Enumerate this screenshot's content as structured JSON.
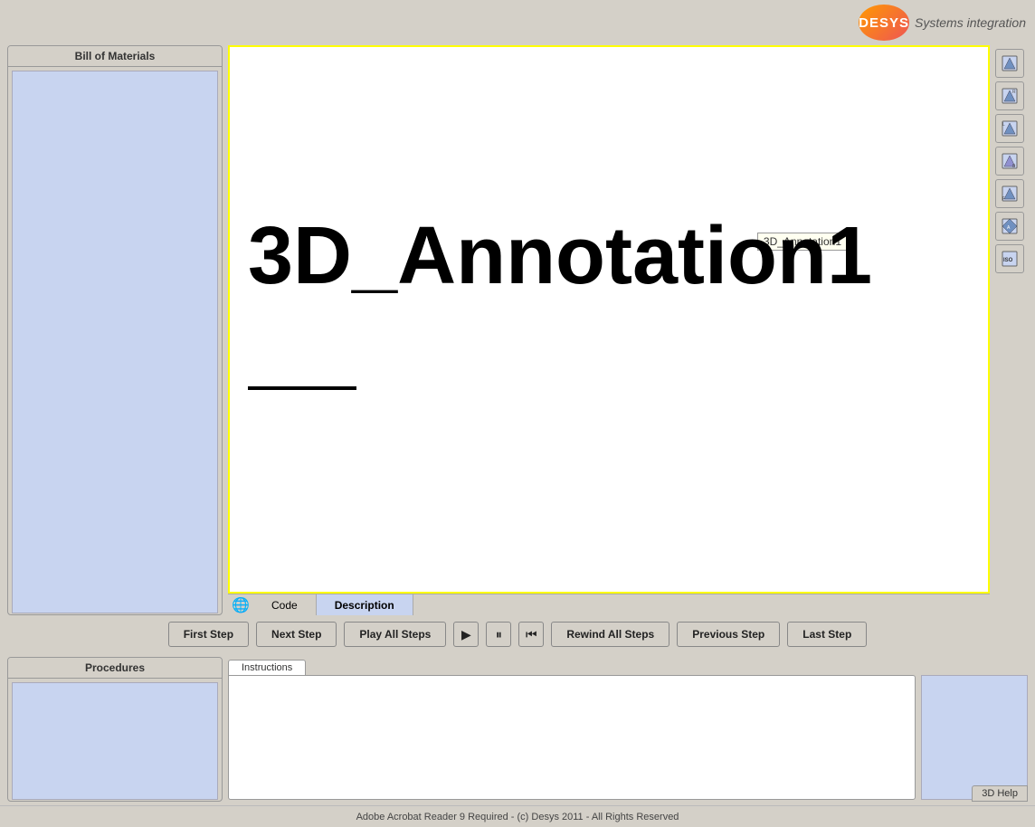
{
  "header": {
    "logo_text": "DESYS",
    "tagline": "Systems integration"
  },
  "bom": {
    "title": "Bill of Materials"
  },
  "viewport": {
    "annotation_tooltip": "3D_Annotation1",
    "annotation_main": "3D_Annotation1"
  },
  "tabs": {
    "code_label": "Code",
    "description_label": "Description"
  },
  "view_buttons": [
    {
      "label": "T",
      "name": "top-view"
    },
    {
      "label": "R",
      "name": "right-view"
    },
    {
      "label": "L",
      "name": "left-view"
    },
    {
      "label": "B",
      "name": "back-view"
    },
    {
      "label": "F",
      "name": "front-view"
    },
    {
      "label": "A",
      "name": "axo-view"
    },
    {
      "label": "ISO",
      "name": "iso-view"
    }
  ],
  "controls": {
    "first_step": "First Step",
    "next_step": "Next Step",
    "play_all": "Play All Steps",
    "play_icon": "▶",
    "pause_icon": "⏸",
    "rewind_icon": "⏮",
    "rewind_all": "Rewind All Steps",
    "prev_step": "Previous Step",
    "last_step": "Last Step"
  },
  "procedures": {
    "title": "Procedures"
  },
  "instructions": {
    "tab_label": "Instructions"
  },
  "help": {
    "btn_label": "3D Help"
  },
  "footer": {
    "text": "Adobe Acrobat Reader 9 Required - (c) Desys 2011 - All Rights Reserved"
  }
}
